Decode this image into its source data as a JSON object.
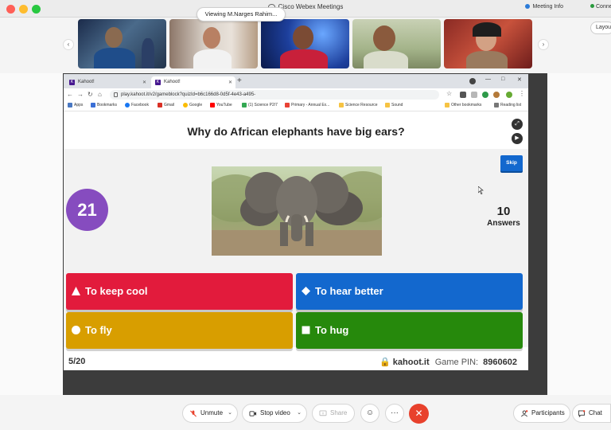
{
  "window": {
    "title": "Cisco Webex Meetings",
    "meeting_info": "Meeting Info",
    "connection": "Connected"
  },
  "participants": {
    "layout_button": "Layout"
  },
  "browser": {
    "tabs": [
      {
        "label": "Kahoot!"
      },
      {
        "label": "Kahoot!"
      }
    ],
    "viewing_badge": "Viewing M.Narges Rahim...",
    "url": "play.kahoot.it/v2/gameblock?quizId=b6c166d8-0d5f-4e43-a495-",
    "bookmarks": [
      {
        "label": "Apps",
        "color": "#4a78c2"
      },
      {
        "label": "Bookmarks",
        "color": "#3b6fd6"
      },
      {
        "label": "Facebook",
        "color": "#1877f2"
      },
      {
        "label": "Gmail",
        "color": "#d93025"
      },
      {
        "label": "Google",
        "color": "#fbbc04"
      },
      {
        "label": "YouTube",
        "color": "#ff0000"
      },
      {
        "label": "(1) Science P2/7",
        "color": "#34a853"
      },
      {
        "label": "Primary - Annual Ex...",
        "color": "#e94235"
      },
      {
        "label": "Science Resource",
        "color": "#f6c343"
      },
      {
        "label": "Sound",
        "color": "#f6c343"
      },
      {
        "label": "Other bookmarks",
        "color": "#f6c343"
      },
      {
        "label": "Reading list",
        "color": "#777777"
      }
    ]
  },
  "kahoot": {
    "question": "Why do African elephants have big ears?",
    "skip_label": "Skip",
    "timer": "21",
    "answers_count": "10",
    "answers_label": "Answers",
    "options": [
      {
        "label": "To keep cool",
        "shape": "triangle",
        "color": "#e21b3c"
      },
      {
        "label": "To hear better",
        "shape": "diamond",
        "color": "#1368ce"
      },
      {
        "label": "To fly",
        "shape": "circle",
        "color": "#d89e00"
      },
      {
        "label": "To hug",
        "shape": "square",
        "color": "#26890c"
      }
    ],
    "progress": "5/20",
    "site": "kahoot.it",
    "pin_label": "Game PIN:",
    "pin": "8960602"
  },
  "toolbar": {
    "unmute": "Unmute",
    "stop_video": "Stop video",
    "share": "Share",
    "more": "···",
    "participants": "Participants",
    "chat": "Chat"
  },
  "colors": {
    "kahoot_purple": "#864cbf",
    "skip_blue": "#1368ce",
    "leave_red": "#e8412c"
  }
}
